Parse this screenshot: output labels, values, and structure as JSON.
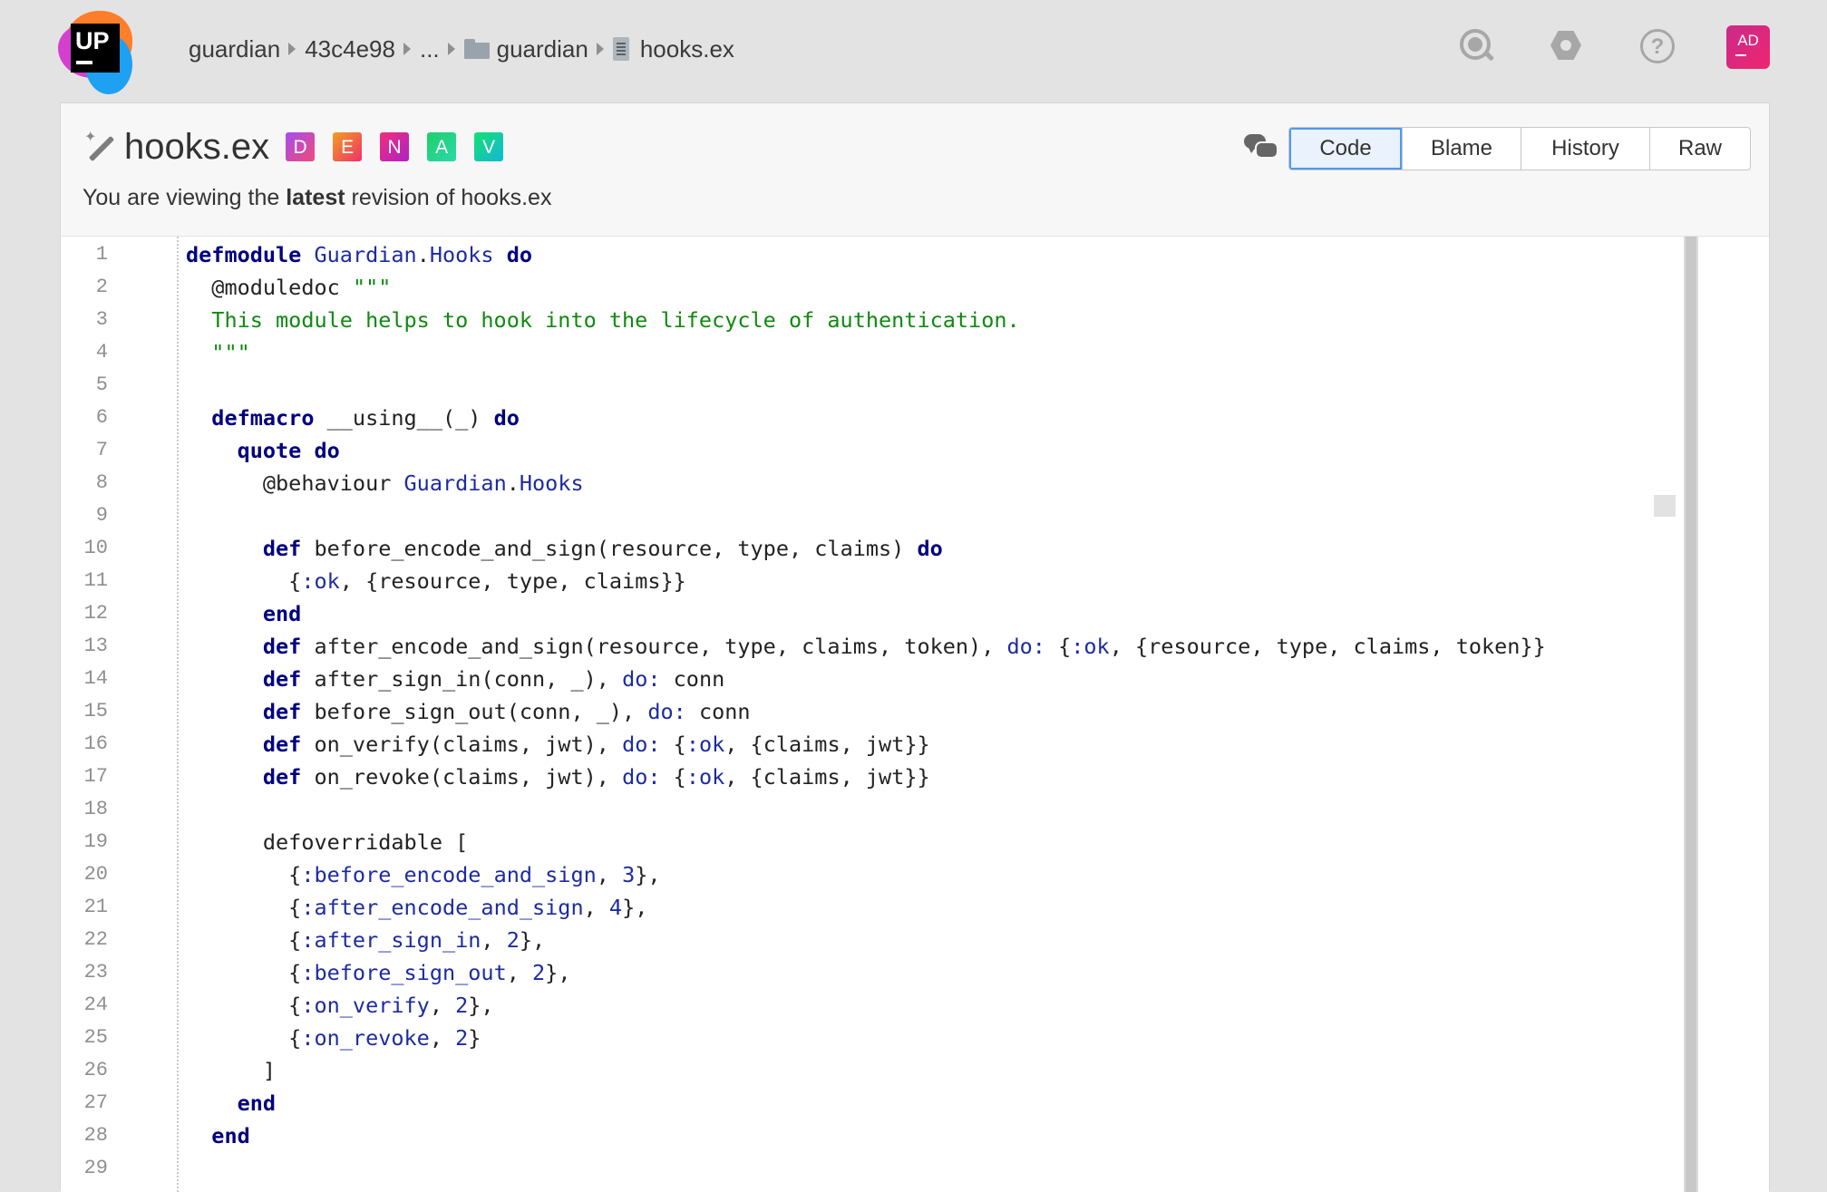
{
  "breadcrumb": {
    "items": [
      "guardian",
      "43c4e98",
      "...",
      "guardian",
      "hooks.ex"
    ]
  },
  "header": {
    "avatar_initials": "AD",
    "logo_text": "UP"
  },
  "file": {
    "name": "hooks.ex",
    "badges": [
      {
        "letter": "D",
        "color": "#c03ed8"
      },
      {
        "letter": "E",
        "color": "#f0503a"
      },
      {
        "letter": "N",
        "color": "#d822a3"
      },
      {
        "letter": "A",
        "color": "#1fcf6a"
      },
      {
        "letter": "V",
        "color": "#14d18e"
      }
    ],
    "viewing_prefix": "You are viewing the ",
    "viewing_bold": "latest",
    "viewing_suffix": " revision of hooks.ex"
  },
  "tabs": [
    {
      "label": "Code",
      "active": true
    },
    {
      "label": "Blame",
      "active": false
    },
    {
      "label": "History",
      "active": false
    },
    {
      "label": "Raw",
      "active": false
    }
  ],
  "code": {
    "language": "elixir",
    "lines": [
      "defmodule Guardian.Hooks do",
      "  @moduledoc \"\"\"",
      "  This module helps to hook into the lifecycle of authentication.",
      "  \"\"\"",
      "",
      "  defmacro __using__(_) do",
      "    quote do",
      "      @behaviour Guardian.Hooks",
      "",
      "      def before_encode_and_sign(resource, type, claims) do",
      "        {:ok, {resource, type, claims}}",
      "      end",
      "      def after_encode_and_sign(resource, type, claims, token), do: {:ok, {resource, type, claims, token}}",
      "      def after_sign_in(conn, _), do: conn",
      "      def before_sign_out(conn, _), do: conn",
      "      def on_verify(claims, jwt), do: {:ok, {claims, jwt}}",
      "      def on_revoke(claims, jwt), do: {:ok, {claims, jwt}}",
      "",
      "      defoverridable [",
      "        {:before_encode_and_sign, 3},",
      "        {:after_encode_and_sign, 4},",
      "        {:after_sign_in, 2},",
      "        {:before_sign_out, 2},",
      "        {:on_verify, 2},",
      "        {:on_revoke, 2}",
      "      ]",
      "    end",
      "  end",
      ""
    ],
    "first_line_number": 1
  },
  "colors": {
    "keyword": "#000080",
    "string": "#0f8a0f",
    "atom": "#1c2ba1",
    "active_tab_border": "#4d9af0"
  },
  "icons": [
    "search-icon",
    "hexagon-settings-icon",
    "help-icon",
    "comments-icon",
    "magic-wand-icon",
    "folder-icon",
    "file-icon"
  ]
}
